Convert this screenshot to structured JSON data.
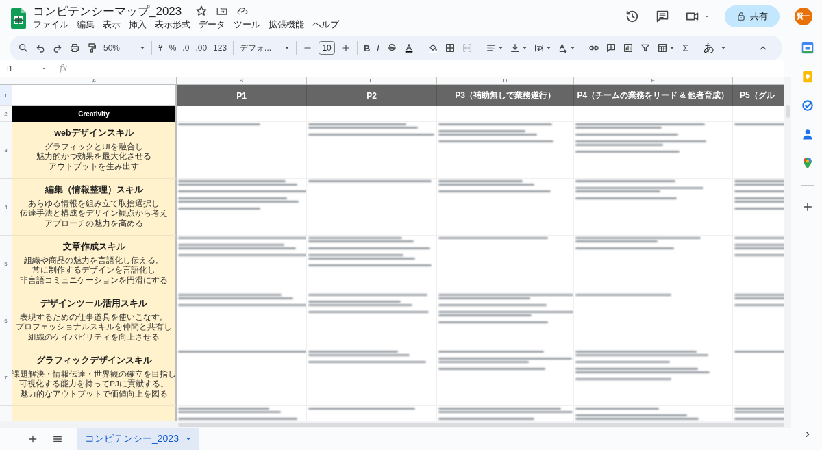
{
  "doc": {
    "title": "コンピテンシーマップ_2023"
  },
  "menu": [
    "ファイル",
    "編集",
    "表示",
    "挿入",
    "表示形式",
    "データ",
    "ツール",
    "拡張機能",
    "ヘルプ"
  ],
  "share": "共有",
  "avatar": "賢一",
  "toolbar": {
    "zoom": "50%",
    "currency": "¥",
    "percent": "%",
    "dec_less": ".0",
    "dec_more": ".00",
    "number_format": "123",
    "font": "デフォ...",
    "font_size": "10",
    "bold": "B",
    "italic": "I",
    "input_tool": "あ"
  },
  "name_box": "I1",
  "fx": "fx",
  "columns": [
    "A",
    "B",
    "C",
    "D",
    "E"
  ],
  "header_row": {
    "row": "1",
    "cells": [
      "P1",
      "P2",
      "P3（補助無しで業務遂行）",
      "P4（チームの業務をリード & 他者育成）",
      "P5（グル"
    ]
  },
  "category": {
    "row": "2",
    "label": "Creativity"
  },
  "skills": [
    {
      "row": "3",
      "name": "webデザインスキル",
      "lines": [
        "グラフィックとUIを融合し",
        "魅力的かつ効果を最大化させる",
        "アウトプットを生み出す"
      ]
    },
    {
      "row": "4",
      "name": "編集（情報整理）スキル",
      "lines": [
        "あらゆる情報を組み立て取捨選択し",
        "伝達手法と構成をデザイン観点から考え",
        "アプローチの魅力を高める"
      ]
    },
    {
      "row": "5",
      "name": "文章作成スキル",
      "lines": [
        "組織や商品の魅力を言語化し伝える。",
        "常に制作するデザインを言語化し",
        "非言語コミュニケーションを円滑にする"
      ]
    },
    {
      "row": "6",
      "name": "デザインツール活用スキル",
      "lines": [
        "表現するための仕事道具を使いこなす。",
        "プロフェッショナルスキルを仲間と共有し",
        "組織のケイパビリティを向上させる"
      ]
    },
    {
      "row": "7",
      "name": "グラフィックデザインスキル",
      "lines": [
        "課題解決・情報伝達・世界観の確立を目指し",
        "可視化する能力を持ってPJに貢献する。",
        "魅力的なアウトプットで価値向上を図る"
      ]
    }
  ],
  "sheet_tabs": [
    {
      "label": "コンピテンシー_2023",
      "selected": true
    }
  ]
}
